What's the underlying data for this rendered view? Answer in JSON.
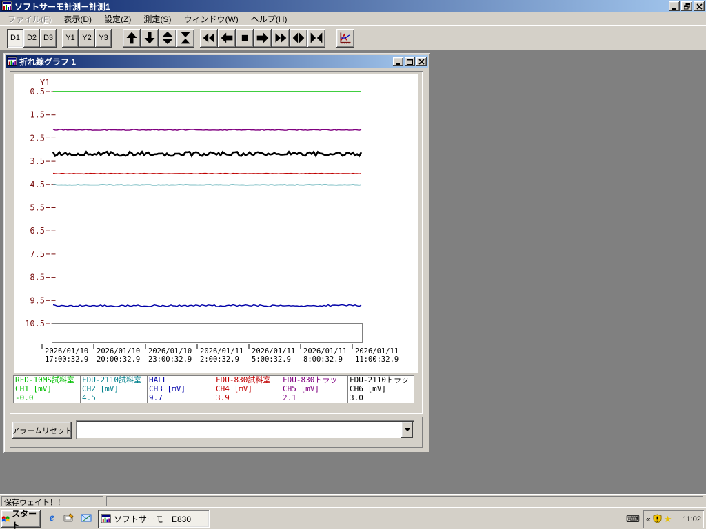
{
  "app_window": {
    "title": "ソフトサーモ計測－計測1",
    "controls": [
      "minimize",
      "restore",
      "close"
    ]
  },
  "menu": {
    "items": [
      {
        "label": "ファイル",
        "key": "F",
        "disabled": true
      },
      {
        "label": "表示",
        "key": "D",
        "disabled": false
      },
      {
        "label": "設定",
        "key": "Z",
        "disabled": false
      },
      {
        "label": "測定",
        "key": "S",
        "disabled": false
      },
      {
        "label": "ウィンドウ",
        "key": "W",
        "disabled": false
      },
      {
        "label": "ヘルプ",
        "key": "H",
        "disabled": false
      }
    ]
  },
  "toolbar": {
    "text_buttons": [
      "D1",
      "D2",
      "D3",
      "Y1",
      "Y2",
      "Y3"
    ],
    "active_button": "D1",
    "icon_buttons": [
      "pan-up",
      "pan-down",
      "expand-y",
      "compress-y",
      "rewind",
      "pan-left",
      "stop",
      "pan-right",
      "fast-forward",
      "expand-x",
      "compress-x",
      "graph-display"
    ]
  },
  "graph_window": {
    "title": "折れ線グラフ 1",
    "controls": [
      "minimize",
      "maximize",
      "close"
    ]
  },
  "chart_data": {
    "type": "line",
    "title": "Y1",
    "y_axis": {
      "label": "Y1",
      "min": 0.5,
      "max": 11.3,
      "inverted_down": true,
      "ticks": [
        "0.5",
        "1.5",
        "2.5",
        "3.5",
        "4.5",
        "5.5",
        "6.5",
        "7.5",
        "8.5",
        "9.5",
        "10.5"
      ],
      "axis_color": "#7b1414"
    },
    "x_axis": {
      "interval_hours": 3,
      "ticks": [
        {
          "date": "2026/01/10",
          "time": "17:00:32.9"
        },
        {
          "date": "2026/01/10",
          "time": "20:00:32.9"
        },
        {
          "date": "2026/01/10",
          "time": "23:00:32.9"
        },
        {
          "date": "2026/01/11",
          "time": "2:00:32.9"
        },
        {
          "date": "2026/01/11",
          "time": "5:00:32.9"
        },
        {
          "date": "2026/01/11",
          "time": "8:00:32.9"
        },
        {
          "date": "2026/01/11",
          "time": "11:00:32.9"
        }
      ]
    },
    "series": [
      {
        "name": "RFD-10MS試料室",
        "channel": "CH1 [mV]",
        "display_value": "-0.0",
        "plot_value": 0.5,
        "clipped_at_top": true,
        "color": "#00bE00",
        "noise": 0,
        "width": 1.4
      },
      {
        "name": "FDU-2110試料室",
        "channel": "CH2 [mV]",
        "display_value": "4.5",
        "plot_value": 4.52,
        "color": "#00808c",
        "noise": 0.008,
        "width": 1.4
      },
      {
        "name": "HALL",
        "channel": "CH3 [mV]",
        "display_value": "9.7",
        "plot_value": 9.72,
        "color": "#0000a8",
        "noise": 0.035,
        "width": 1.4
      },
      {
        "name": "FDU-830試料室",
        "channel": "CH4 [mV]",
        "display_value": "3.9",
        "plot_value": 4.03,
        "color": "#c00000",
        "noise": 0.012,
        "width": 1.4
      },
      {
        "name": "FDU-830トラッ",
        "channel": "CH5 [mV]",
        "display_value": "2.1",
        "plot_value": 2.15,
        "color": "#800080",
        "noise": 0.018,
        "width": 1.4
      },
      {
        "name": "FDU-2110トラッ",
        "channel": "CH6 [mV]",
        "display_value": "3.0",
        "plot_value": 3.18,
        "color": "#000000",
        "noise": 0.09,
        "width": 2.6
      }
    ],
    "alarm_bar": {
      "fill": "#ffffff",
      "border": "#000000"
    }
  },
  "alarm": {
    "reset_label": "アラームリセット",
    "combo_value": ""
  },
  "statusbar": {
    "message": "保存ウェイト！！"
  },
  "taskbar": {
    "start_label": "スタート",
    "quick_launch_icons": [
      "internet-explorer-icon",
      "show-desktop-icon",
      "outlook-express-icon"
    ],
    "task_label": "ソフトサーモ　E830",
    "tray_icons": [
      "keyboard-icon",
      "collapse-chevron",
      "security-shield-icon",
      "favorites-star-icon"
    ],
    "chevron": "«",
    "clock": "11:02"
  }
}
